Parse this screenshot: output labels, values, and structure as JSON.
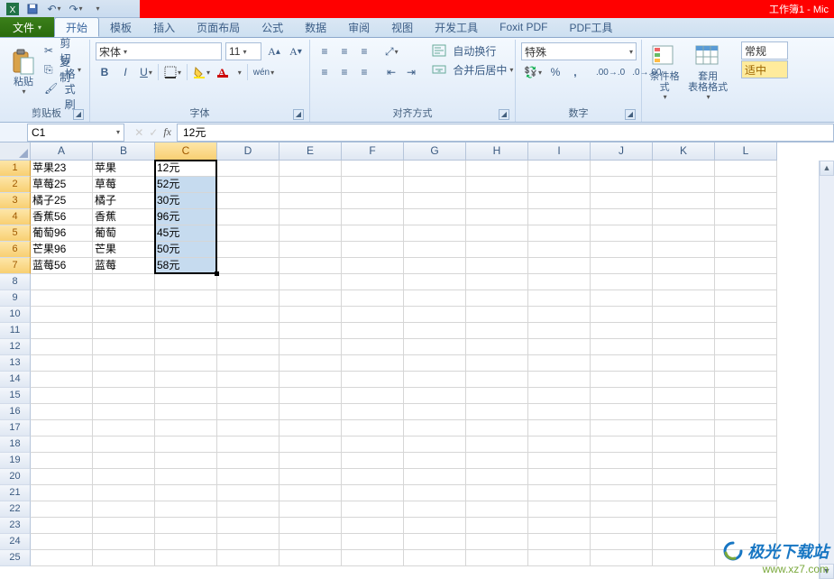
{
  "titlebar": {
    "doc_hint": "工作簿1 - Mic"
  },
  "tabs": {
    "file": "文件",
    "items": [
      "开始",
      "模板",
      "插入",
      "页面布局",
      "公式",
      "数据",
      "审阅",
      "视图",
      "开发工具",
      "Foxit PDF",
      "PDF工具"
    ],
    "active_index": 0
  },
  "ribbon": {
    "clipboard": {
      "label": "剪贴板",
      "paste": "粘贴",
      "cut": "剪切",
      "copy": "复制",
      "format_painter": "格式刷"
    },
    "font": {
      "label": "字体",
      "family": "宋体",
      "size": "11"
    },
    "alignment": {
      "label": "对齐方式",
      "wrap": "自动换行",
      "merge": "合并后居中"
    },
    "number": {
      "label": "数字",
      "format": "特殊"
    },
    "styles": {
      "cond_format": "条件格式",
      "table_format": "套用\n表格格式"
    },
    "right": {
      "category": "常规",
      "fit": "适中"
    }
  },
  "nameBox": "C1",
  "formula": "12元",
  "columns": [
    "A",
    "B",
    "C",
    "D",
    "E",
    "F",
    "G",
    "H",
    "I",
    "J",
    "K",
    "L"
  ],
  "rowCount": 25,
  "data": {
    "rows": [
      {
        "A": "苹果23",
        "B": "苹果",
        "C": "12元"
      },
      {
        "A": "草莓25",
        "B": "草莓",
        "C": "52元"
      },
      {
        "A": "橘子25",
        "B": "橘子",
        "C": "30元"
      },
      {
        "A": "香蕉56",
        "B": "香蕉",
        "C": "96元"
      },
      {
        "A": "葡萄96",
        "B": "葡萄",
        "C": "45元"
      },
      {
        "A": "芒果96",
        "B": "芒果",
        "C": "50元"
      },
      {
        "A": "蓝莓56",
        "B": "蓝莓",
        "C": "58元"
      }
    ]
  },
  "selection": {
    "col": "C",
    "rowStart": 1,
    "rowEnd": 7
  },
  "watermark": {
    "line1": "极光下载站",
    "line2": "www.xz7.com"
  }
}
